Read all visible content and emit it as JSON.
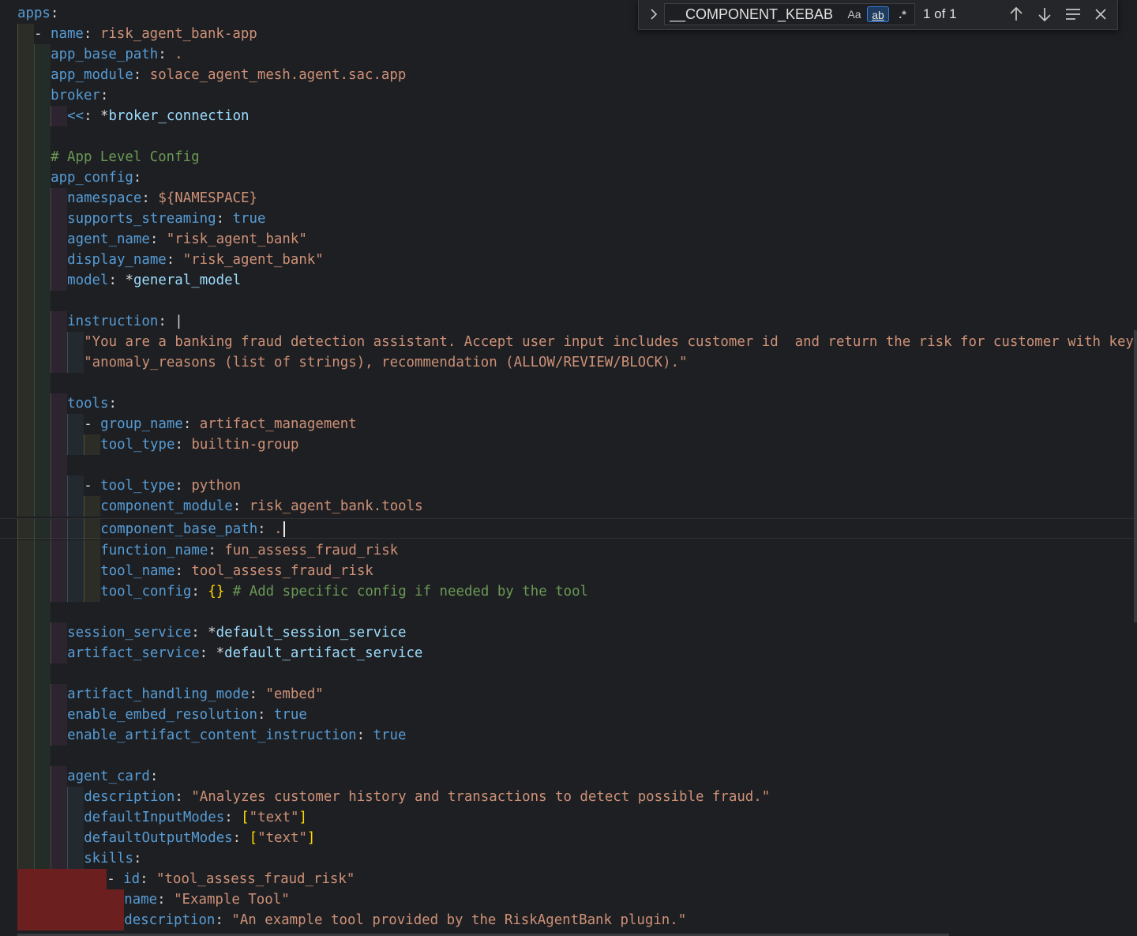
{
  "find_widget": {
    "query": "__COMPONENT_KEBAB",
    "match_case_label": "Aa",
    "whole_word_label": "ab",
    "regex_label": ".*",
    "match_count": "1 of 1",
    "icons": {
      "toggle_replace": "chevron-right-icon",
      "previous": "arrow-up-icon",
      "next": "arrow-down-icon",
      "in_selection": "lines-icon",
      "close": "close-icon"
    }
  },
  "colors": {
    "background": "#1e1f22",
    "key": "#569cd6",
    "string": "#ce9178",
    "comment": "#6a9955",
    "reference": "#9cdcfe",
    "bracket": "#ffd700",
    "punctuation": "#d4d4d4"
  },
  "code": {
    "l1": {
      "key": "apps"
    },
    "l2": {
      "dash": "- ",
      "key": "name",
      "value": "risk_agent_bank-app"
    },
    "l3": {
      "key": "app_base_path",
      "value": "."
    },
    "l4": {
      "key": "app_module",
      "value": "solace_agent_mesh.agent.sac.app"
    },
    "l5": {
      "key": "broker"
    },
    "l6": {
      "key": "<<",
      "star": "*",
      "ref": "broker_connection"
    },
    "l8": {
      "comment": "# App Level Config"
    },
    "l9": {
      "key": "app_config"
    },
    "l10": {
      "key": "namespace",
      "value": "${NAMESPACE}"
    },
    "l11": {
      "key": "supports_streaming",
      "value": "true"
    },
    "l12": {
      "key": "agent_name",
      "value": "\"risk_agent_bank\""
    },
    "l13": {
      "key": "display_name",
      "value": "\"risk_agent_bank\""
    },
    "l14": {
      "key": "model",
      "star": "*",
      "ref": "general_model"
    },
    "l16": {
      "key": "instruction",
      "value": "|"
    },
    "l17": {
      "text": "\"You are a banking fraud detection assistant. Accept user input includes customer id  and return the risk for customer with key"
    },
    "l18": {
      "text": "\"anomaly_reasons (list of strings), recommendation (ALLOW/REVIEW/BLOCK).\""
    },
    "l20": {
      "key": "tools"
    },
    "l21": {
      "dash": "- ",
      "key": "group_name",
      "value": "artifact_management"
    },
    "l22": {
      "key": "tool_type",
      "value": "builtin-group"
    },
    "l24": {
      "dash": "- ",
      "key": "tool_type",
      "value": "python"
    },
    "l25": {
      "key": "component_module",
      "value": "risk_agent_bank.tools"
    },
    "l26": {
      "key": "component_base_path",
      "value": "."
    },
    "l27": {
      "key": "function_name",
      "value": "fun_assess_fraud_risk"
    },
    "l28": {
      "key": "tool_name",
      "value": "tool_assess_fraud_risk"
    },
    "l29": {
      "key": "tool_config",
      "value": "{}",
      "comment": "# Add specific config if needed by the tool"
    },
    "l31": {
      "key": "session_service",
      "star": "*",
      "ref": "default_session_service"
    },
    "l32": {
      "key": "artifact_service",
      "star": "*",
      "ref": "default_artifact_service"
    },
    "l34": {
      "key": "artifact_handling_mode",
      "value": "\"embed\""
    },
    "l35": {
      "key": "enable_embed_resolution",
      "value": "true"
    },
    "l36": {
      "key": "enable_artifact_content_instruction",
      "value": "true"
    },
    "l38": {
      "key": "agent_card"
    },
    "l39": {
      "key": "description",
      "value": "\"Analyzes customer history and transactions to detect possible fraud.\""
    },
    "l40": {
      "key": "defaultInputModes",
      "open": "[",
      "value": "\"text\"",
      "close": "]"
    },
    "l41": {
      "key": "defaultOutputModes",
      "open": "[",
      "value": "\"text\"",
      "close": "]"
    },
    "l42": {
      "key": "skills"
    },
    "l43": {
      "dash": "- ",
      "key": "id",
      "value": "\"tool_assess_fraud_risk\""
    },
    "l44": {
      "key": "name",
      "value": "\"Example Tool\""
    },
    "l45": {
      "key": "description",
      "value": "\"An example tool provided by the RiskAgentBank plugin.\""
    }
  }
}
